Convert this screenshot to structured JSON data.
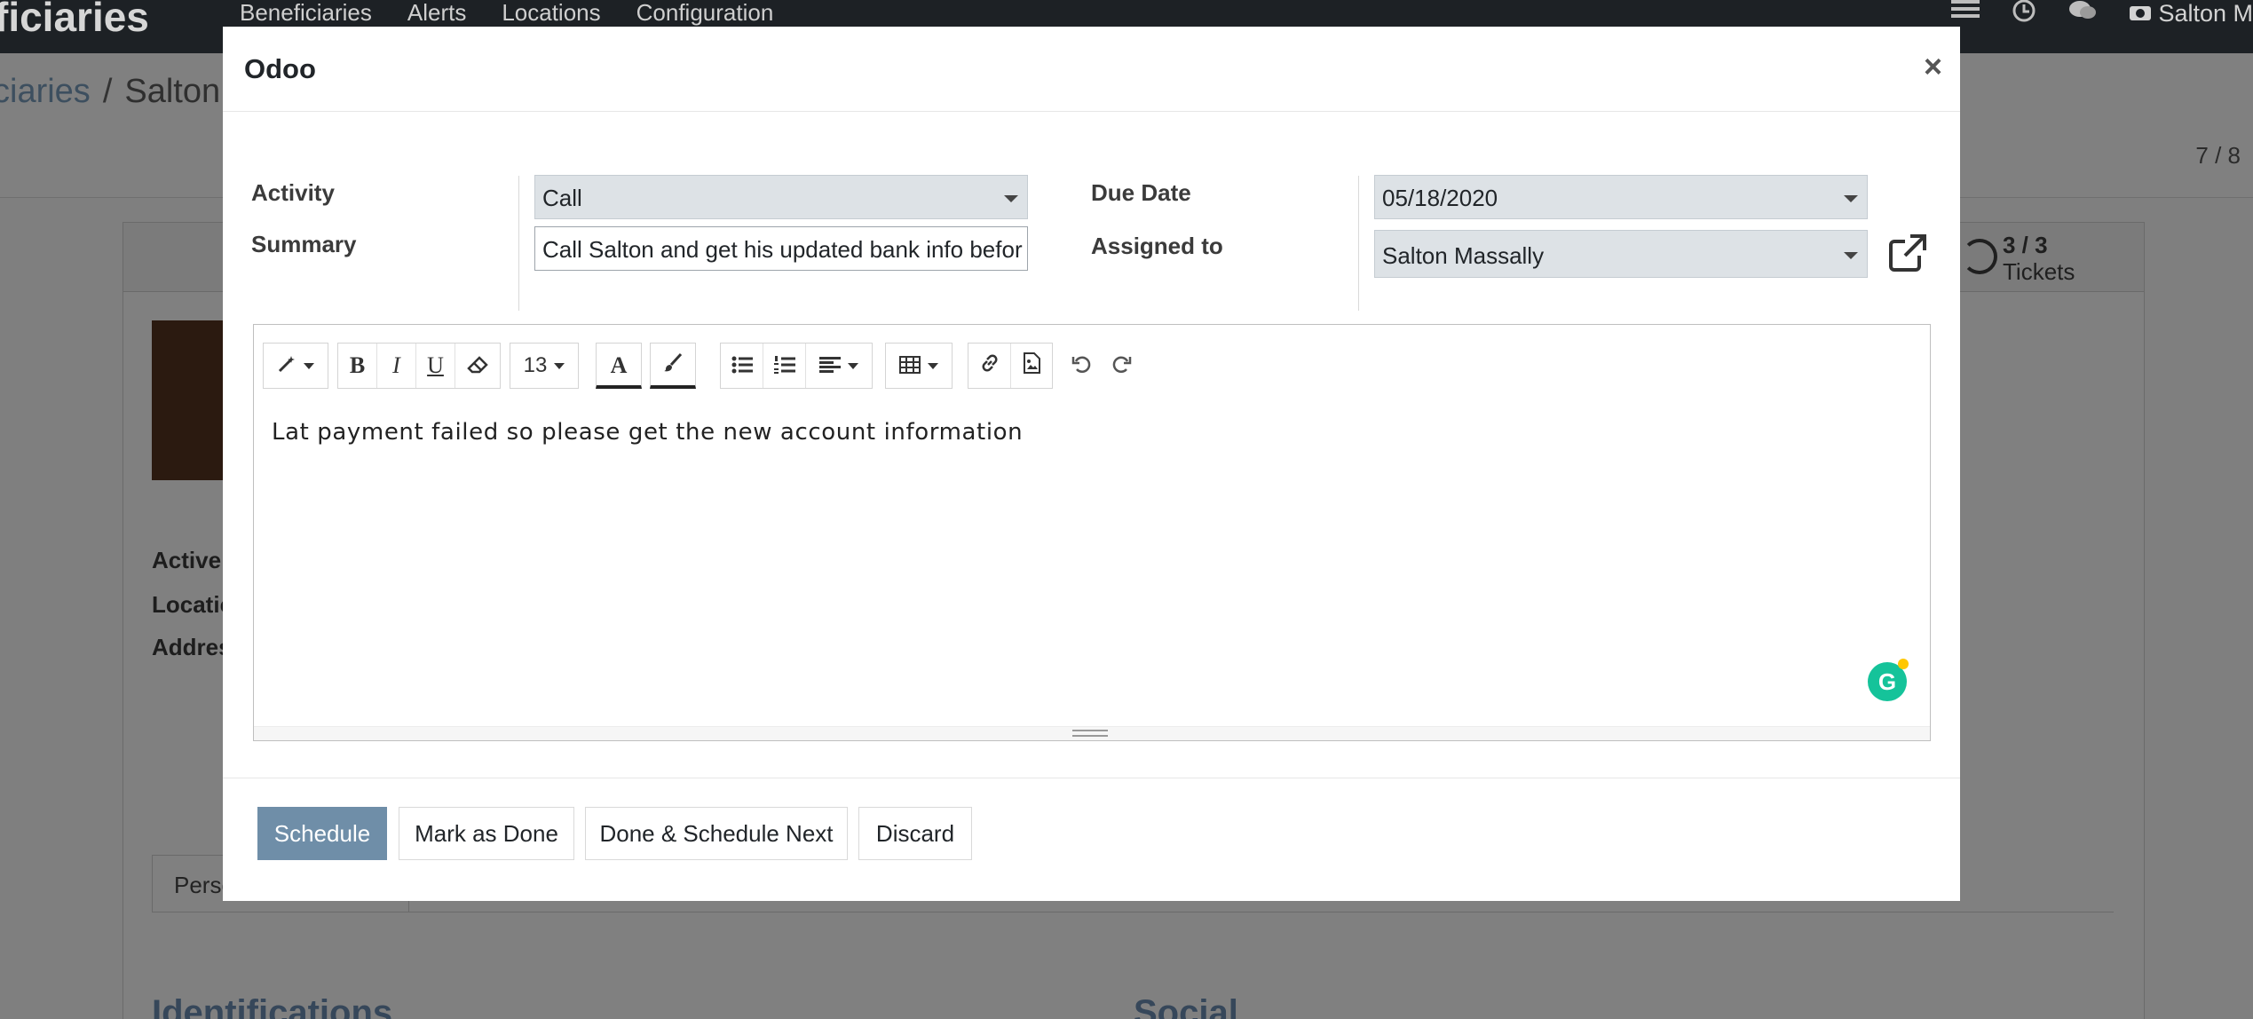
{
  "app_nav": {
    "brand": "ficiaries",
    "menu": [
      "Beneficiaries",
      "Alerts",
      "Locations",
      "Configuration"
    ],
    "user": "Salton M"
  },
  "breadcrumb": {
    "parent": "ciaries",
    "separator": "/",
    "current": "Salton"
  },
  "pager": "7 / 8",
  "smart_button": {
    "value": "3 / 3",
    "label": "Tickets"
  },
  "background_form": {
    "labels": [
      "Active",
      "Locatic",
      "Addres"
    ],
    "tab": "Perso",
    "sections": [
      "Identifications",
      "Social"
    ]
  },
  "modal": {
    "title": "Odoo",
    "close_glyph": "×",
    "fields": {
      "activity_label": "Activity",
      "activity_value": "Call",
      "summary_label": "Summary",
      "summary_value": "Call Salton and get his updated bank info befor",
      "due_date_label": "Due Date",
      "due_date_value": "05/18/2020",
      "assigned_label": "Assigned to",
      "assigned_value": "Salton Massally"
    },
    "toolbar": {
      "font_size": "13",
      "bold": "B",
      "italic": "I",
      "underline": "U",
      "font_color": "A"
    },
    "note_text": "Lat payment failed so please get the new account information",
    "buttons": {
      "schedule": "Schedule",
      "mark_done": "Mark as Done",
      "done_next": "Done & Schedule Next",
      "discard": "Discard"
    }
  },
  "colors": {
    "primary": "#6f8ea8",
    "navbar": "#1d2125",
    "select_bg": "#dde2e6",
    "grammarly": "#15c39a"
  }
}
